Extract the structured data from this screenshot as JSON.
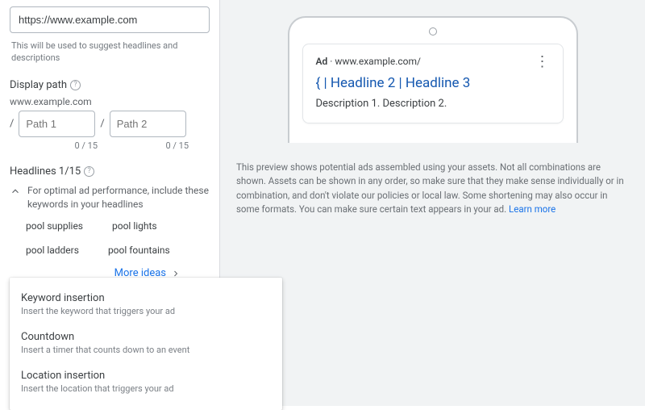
{
  "url_field": {
    "value": "https://www.example.com"
  },
  "url_helper": "This will be used to suggest headlines and descriptions",
  "display_path": {
    "label": "Display path",
    "domain": "www.example.com",
    "path1_placeholder": "Path 1",
    "path1_counter": "0 / 15",
    "path2_placeholder": "Path 2",
    "path2_counter": "0 / 15"
  },
  "headlines": {
    "label": "Headlines 1/15",
    "tip": "For optimal ad performance, include these keywords in your headlines",
    "keywords": [
      "pool supplies",
      "pool lights",
      "pool ladders",
      "pool fountains"
    ],
    "more_ideas": "More ideas",
    "input_value": "{|"
  },
  "dropdown": {
    "items": [
      {
        "title": "Keyword insertion",
        "desc": "Insert the keyword that triggers your ad"
      },
      {
        "title": "Countdown",
        "desc": "Insert a timer that counts down to an event"
      },
      {
        "title": "Location insertion",
        "desc": "Insert the location that triggers your ad"
      }
    ]
  },
  "preview": {
    "ad_label": "Ad",
    "ad_sep": " · ",
    "ad_domain": "www.example.com/",
    "headlines_text": "{ | Headline 2 | Headline 3",
    "descriptions_text": "Description 1. Description 2.",
    "note": "This preview shows potential ads assembled using your assets. Not all combinations are shown. Assets can be shown in any order, so make sure that they make sense individually or in combination, and don't violate our policies or local law. Some shortening may also occur in some formats. You can make sure certain text appears in your ad. ",
    "learn_more": "Learn more"
  }
}
